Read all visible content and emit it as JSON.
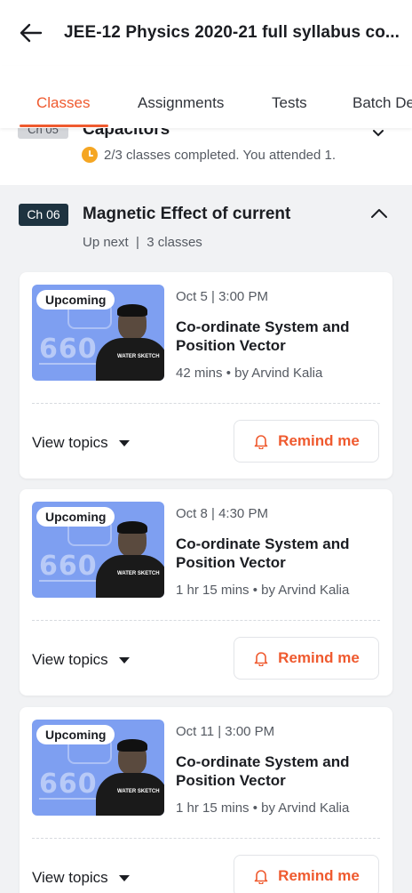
{
  "header": {
    "title": "JEE-12 Physics 2020-21 full syllabus co..."
  },
  "tabs": [
    {
      "label": "Classes"
    },
    {
      "label": "Assignments"
    },
    {
      "label": "Tests"
    },
    {
      "label": "Batch De"
    }
  ],
  "previous_chapter": {
    "badge": "Ch 05",
    "name": "Capacitors",
    "status": "2/3 classes completed. You attended 1."
  },
  "chapter": {
    "badge": "Ch 06",
    "name": "Magnetic Effect of current",
    "meta": "Up next  |  3 classes"
  },
  "classes": [
    {
      "badge": "Upcoming",
      "date": "Oct 5 | 3:00 PM",
      "title": "Co-ordinate System and Position Vector",
      "meta": "42 mins • by Arvind Kalia",
      "view_topics": "View topics",
      "remind": "Remind me"
    },
    {
      "badge": "Upcoming",
      "date": "Oct 8 | 4:30 PM",
      "title": "Co-ordinate System and Position Vector",
      "meta": "1 hr 15 mins • by Arvind Kalia",
      "view_topics": "View topics",
      "remind": "Remind me"
    },
    {
      "badge": "Upcoming",
      "date": "Oct 11 | 3:00 PM",
      "title": "Co-ordinate System and Position Vector",
      "meta": "1 hr 15 mins • by Arvind Kalia",
      "view_topics": "View topics",
      "remind": "Remind me"
    }
  ],
  "colors": {
    "accent": "#ef5a2f",
    "chapter_badge": "#1e3340",
    "thumbnail": "#7e9ff1",
    "clock": "#f5a623"
  }
}
